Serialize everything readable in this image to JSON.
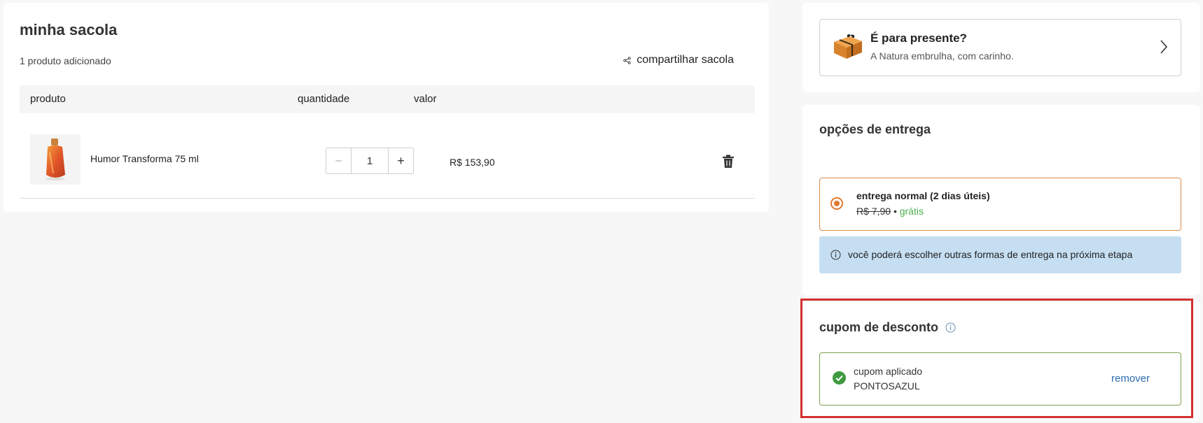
{
  "bag": {
    "title": "minha sacola",
    "count_text": "1 produto adicionado",
    "share_label": "compartilhar sacola",
    "columns": {
      "product": "produto",
      "quantity": "quantidade",
      "value": "valor"
    },
    "items": [
      {
        "name": "Humor Transforma 75 ml",
        "quantity": "1",
        "price": "R$ 153,90"
      }
    ]
  },
  "gift": {
    "title": "É para presente?",
    "subtitle": "A Natura embrulha, com carinho."
  },
  "delivery": {
    "title": "opções de entrega",
    "option": {
      "label": "entrega normal (2 dias úteis)",
      "old_price": "R$ 7,90",
      "separator": "•",
      "price": "grátis"
    },
    "info": "você poderá escolher outras formas de entrega na próxima etapa"
  },
  "coupon": {
    "title": "cupom de desconto",
    "status": "cupom aplicado",
    "code": "PONTOSAZUL",
    "remove_label": "remover"
  },
  "colors": {
    "accent_orange": "#e07a2e",
    "success_green": "#4caf50",
    "info_blue": "#c5def2",
    "link_blue": "#2b6cb0",
    "highlight_red": "#d32f2f"
  }
}
